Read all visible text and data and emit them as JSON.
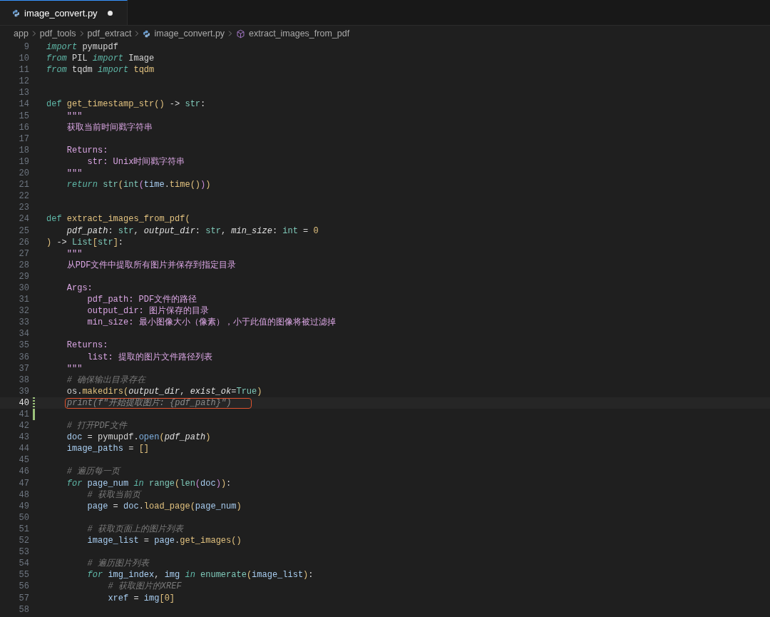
{
  "tabs": [
    {
      "label": "image_convert.py",
      "selected": true,
      "modified": true
    }
  ],
  "breadcrumb": [
    {
      "label": "app",
      "kind": "folder"
    },
    {
      "label": "pdf_tools",
      "kind": "folder"
    },
    {
      "label": "pdf_extract",
      "kind": "folder"
    },
    {
      "label": "image_convert.py",
      "kind": "file"
    },
    {
      "label": "extract_images_from_pdf",
      "kind": "symbol"
    }
  ],
  "lines": [
    {
      "number": "9",
      "current": false,
      "tokens": [
        {
          "text": "import",
          "kind": "control"
        },
        {
          "text": " pymupdf",
          "kind": "plain"
        }
      ]
    },
    {
      "number": "10",
      "current": false,
      "tokens": [
        {
          "text": "from",
          "kind": "control"
        },
        {
          "text": " PIL ",
          "kind": "plain"
        },
        {
          "text": "import",
          "kind": "control"
        },
        {
          "text": " Image",
          "kind": "plain"
        }
      ]
    },
    {
      "number": "11",
      "current": false,
      "tokens": [
        {
          "text": "from",
          "kind": "control"
        },
        {
          "text": " tqdm ",
          "kind": "plain"
        },
        {
          "text": "import",
          "kind": "control"
        },
        {
          "text": " tqdm",
          "kind": "function"
        }
      ]
    },
    {
      "number": "12",
      "current": false
    },
    {
      "number": "13",
      "current": false
    },
    {
      "number": "14",
      "current": false,
      "tokens": [
        {
          "text": "def ",
          "kind": "keyword"
        },
        {
          "text": "get_timestamp_str",
          "kind": "function"
        },
        {
          "text": "()",
          "kind": "bracket"
        },
        {
          "text": " -> ",
          "kind": "operator"
        },
        {
          "text": "str",
          "kind": "builtin"
        },
        {
          "text": ":",
          "kind": "operator"
        }
      ]
    },
    {
      "number": "15",
      "current": false,
      "tokens": [
        {
          "text": "    \"\"\"",
          "kind": "docstring"
        }
      ]
    },
    {
      "number": "16",
      "current": false,
      "tokens": [
        {
          "text": "    获取当前时间戳字符串",
          "kind": "docstring"
        }
      ]
    },
    {
      "number": "17",
      "current": false
    },
    {
      "number": "18",
      "current": false,
      "tokens": [
        {
          "text": "    Returns:",
          "kind": "docstring"
        }
      ]
    },
    {
      "number": "19",
      "current": false,
      "tokens": [
        {
          "text": "        str: Unix时间戳字符串",
          "kind": "docstring"
        }
      ]
    },
    {
      "number": "20",
      "current": false,
      "tokens": [
        {
          "text": "    \"\"\"",
          "kind": "docstring"
        }
      ]
    },
    {
      "number": "21",
      "current": false,
      "tokens": [
        {
          "text": "    return ",
          "kind": "control"
        },
        {
          "text": "str",
          "kind": "builtin"
        },
        {
          "text": "(",
          "kind": "bracket"
        },
        {
          "text": "int",
          "kind": "builtin"
        },
        {
          "text": "(",
          "kind": "brace"
        },
        {
          "text": "time",
          "kind": "variable"
        },
        {
          "text": ".",
          "kind": "operator"
        },
        {
          "text": "time",
          "kind": "function"
        },
        {
          "text": "()",
          "kind": "bracket"
        },
        {
          "text": ")",
          "kind": "brace"
        },
        {
          "text": ")",
          "kind": "bracket"
        }
      ]
    },
    {
      "number": "22",
      "current": false
    },
    {
      "number": "23",
      "current": false
    },
    {
      "number": "24",
      "current": false,
      "tokens": [
        {
          "text": "def ",
          "kind": "keyword"
        },
        {
          "text": "extract_images_from_pdf",
          "kind": "function"
        },
        {
          "text": "(",
          "kind": "bracket"
        }
      ]
    },
    {
      "number": "25",
      "current": false,
      "tokens": [
        {
          "text": "    pdf_path",
          "kind": "parameter"
        },
        {
          "text": ": ",
          "kind": "operator"
        },
        {
          "text": "str",
          "kind": "builtin"
        },
        {
          "text": ", ",
          "kind": "operator"
        },
        {
          "text": "output_dir",
          "kind": "parameter"
        },
        {
          "text": ": ",
          "kind": "operator"
        },
        {
          "text": "str",
          "kind": "builtin"
        },
        {
          "text": ", ",
          "kind": "operator"
        },
        {
          "text": "min_size",
          "kind": "parameter"
        },
        {
          "text": ": ",
          "kind": "operator"
        },
        {
          "text": "int",
          "kind": "builtin"
        },
        {
          "text": " = ",
          "kind": "operator"
        },
        {
          "text": "0",
          "kind": "number"
        }
      ]
    },
    {
      "number": "26",
      "current": false,
      "tokens": [
        {
          "text": ")",
          "kind": "bracket"
        },
        {
          "text": " -> ",
          "kind": "operator"
        },
        {
          "text": "List",
          "kind": "builtin"
        },
        {
          "text": "[",
          "kind": "bracket"
        },
        {
          "text": "str",
          "kind": "builtin"
        },
        {
          "text": "]",
          "kind": "bracket"
        },
        {
          "text": ":",
          "kind": "operator"
        }
      ]
    },
    {
      "number": "27",
      "current": false,
      "tokens": [
        {
          "text": "    \"\"\"",
          "kind": "docstring"
        }
      ]
    },
    {
      "number": "28",
      "current": false,
      "tokens": [
        {
          "text": "    从PDF文件中提取所有图片并保存到指定目录",
          "kind": "docstring"
        }
      ]
    },
    {
      "number": "29",
      "current": false
    },
    {
      "number": "30",
      "current": false,
      "tokens": [
        {
          "text": "    Args:",
          "kind": "docstring"
        }
      ]
    },
    {
      "number": "31",
      "current": false,
      "tokens": [
        {
          "text": "        pdf_path: PDF文件的路径",
          "kind": "docstring"
        }
      ]
    },
    {
      "number": "32",
      "current": false,
      "tokens": [
        {
          "text": "        output_dir: 图片保存的目录",
          "kind": "docstring"
        }
      ]
    },
    {
      "number": "33",
      "current": false,
      "tokens": [
        {
          "text": "        min_size: 最小图像大小（像素），小于此值的图像将被过滤掉",
          "kind": "docstring"
        }
      ]
    },
    {
      "number": "34",
      "current": false
    },
    {
      "number": "35",
      "current": false,
      "tokens": [
        {
          "text": "    Returns:",
          "kind": "docstring"
        }
      ]
    },
    {
      "number": "36",
      "current": false,
      "tokens": [
        {
          "text": "        list: 提取的图片文件路径列表",
          "kind": "docstring"
        }
      ]
    },
    {
      "number": "37",
      "current": false,
      "tokens": [
        {
          "text": "    \"\"\"",
          "kind": "docstring"
        }
      ]
    },
    {
      "number": "38",
      "current": false,
      "tokens": [
        {
          "text": "    # 确保输出目录存在",
          "kind": "comment"
        }
      ]
    },
    {
      "number": "39",
      "current": false,
      "tokens": [
        {
          "text": "    os",
          "kind": "plain"
        },
        {
          "text": ".",
          "kind": "operator"
        },
        {
          "text": "makedirs",
          "kind": "function"
        },
        {
          "text": "(",
          "kind": "bracket"
        },
        {
          "text": "output_dir",
          "kind": "parameter"
        },
        {
          "text": ", ",
          "kind": "operator"
        },
        {
          "text": "exist_ok",
          "kind": "parameter"
        },
        {
          "text": "=",
          "kind": "operator"
        },
        {
          "text": "True",
          "kind": "builtin"
        },
        {
          "text": ")",
          "kind": "bracket"
        }
      ]
    },
    {
      "number": "40",
      "current": true,
      "kind": "modified",
      "boxed": true,
      "tokens": [
        {
          "text": "print(f\"开始提取图片: {pdf_path}\")",
          "kind": "ghost"
        }
      ]
    },
    {
      "number": "41",
      "current": false,
      "kind": "added"
    },
    {
      "number": "42",
      "current": false,
      "tokens": [
        {
          "text": "    # 打开PDF文件",
          "kind": "comment"
        }
      ]
    },
    {
      "number": "43",
      "current": false,
      "tokens": [
        {
          "text": "    doc",
          "kind": "variable"
        },
        {
          "text": " = ",
          "kind": "operator"
        },
        {
          "text": "pymupdf",
          "kind": "plain"
        },
        {
          "text": ".",
          "kind": "operator"
        },
        {
          "text": "open",
          "kind": "method"
        },
        {
          "text": "(",
          "kind": "bracket"
        },
        {
          "text": "pdf_path",
          "kind": "parameter"
        },
        {
          "text": ")",
          "kind": "bracket"
        }
      ]
    },
    {
      "number": "44",
      "current": false,
      "tokens": [
        {
          "text": "    image_paths",
          "kind": "variable"
        },
        {
          "text": " = ",
          "kind": "operator"
        },
        {
          "text": "[]",
          "kind": "bracket"
        }
      ]
    },
    {
      "number": "45",
      "current": false
    },
    {
      "number": "46",
      "current": false,
      "tokens": [
        {
          "text": "    # 遍历每一页",
          "kind": "comment"
        }
      ]
    },
    {
      "number": "47",
      "current": false,
      "tokens": [
        {
          "text": "    for ",
          "kind": "control"
        },
        {
          "text": "page_num ",
          "kind": "variable"
        },
        {
          "text": "in ",
          "kind": "control"
        },
        {
          "text": "range",
          "kind": "builtin"
        },
        {
          "text": "(",
          "kind": "bracket"
        },
        {
          "text": "len",
          "kind": "builtin"
        },
        {
          "text": "(",
          "kind": "brace"
        },
        {
          "text": "doc",
          "kind": "variable"
        },
        {
          "text": ")",
          "kind": "brace"
        },
        {
          "text": ")",
          "kind": "bracket"
        },
        {
          "text": ":",
          "kind": "operator"
        }
      ]
    },
    {
      "number": "48",
      "current": false,
      "tokens": [
        {
          "text": "        # 获取当前页",
          "kind": "comment"
        }
      ]
    },
    {
      "number": "49",
      "current": false,
      "tokens": [
        {
          "text": "        page",
          "kind": "variable"
        },
        {
          "text": " = ",
          "kind": "operator"
        },
        {
          "text": "doc",
          "kind": "variable"
        },
        {
          "text": ".",
          "kind": "operator"
        },
        {
          "text": "load_page",
          "kind": "function"
        },
        {
          "text": "(",
          "kind": "bracket"
        },
        {
          "text": "page_num",
          "kind": "variable"
        },
        {
          "text": ")",
          "kind": "bracket"
        }
      ]
    },
    {
      "number": "50",
      "current": false
    },
    {
      "number": "51",
      "current": false,
      "tokens": [
        {
          "text": "        # 获取页面上的图片列表",
          "kind": "comment"
        }
      ]
    },
    {
      "number": "52",
      "current": false,
      "tokens": [
        {
          "text": "        image_list",
          "kind": "variable"
        },
        {
          "text": " = ",
          "kind": "operator"
        },
        {
          "text": "page",
          "kind": "variable"
        },
        {
          "text": ".",
          "kind": "operator"
        },
        {
          "text": "get_images",
          "kind": "function"
        },
        {
          "text": "()",
          "kind": "bracket"
        }
      ]
    },
    {
      "number": "53",
      "current": false
    },
    {
      "number": "54",
      "current": false,
      "tokens": [
        {
          "text": "        # 遍历图片列表",
          "kind": "comment"
        }
      ]
    },
    {
      "number": "55",
      "current": false,
      "tokens": [
        {
          "text": "        for ",
          "kind": "control"
        },
        {
          "text": "img_index",
          "kind": "variable"
        },
        {
          "text": ", ",
          "kind": "operator"
        },
        {
          "text": "img ",
          "kind": "variable"
        },
        {
          "text": "in ",
          "kind": "control"
        },
        {
          "text": "enumerate",
          "kind": "builtin"
        },
        {
          "text": "(",
          "kind": "bracket"
        },
        {
          "text": "image_list",
          "kind": "variable"
        },
        {
          "text": ")",
          "kind": "bracket"
        },
        {
          "text": ":",
          "kind": "operator"
        }
      ]
    },
    {
      "number": "56",
      "current": false,
      "tokens": [
        {
          "text": "            # 获取图片的XREF",
          "kind": "comment"
        }
      ]
    },
    {
      "number": "57",
      "current": false,
      "tokens": [
        {
          "text": "            xref",
          "kind": "variable"
        },
        {
          "text": " = ",
          "kind": "operator"
        },
        {
          "text": "img",
          "kind": "variable"
        },
        {
          "text": "[",
          "kind": "bracket"
        },
        {
          "text": "0",
          "kind": "number"
        },
        {
          "text": "]",
          "kind": "bracket"
        }
      ]
    },
    {
      "number": "58",
      "current": false
    }
  ]
}
